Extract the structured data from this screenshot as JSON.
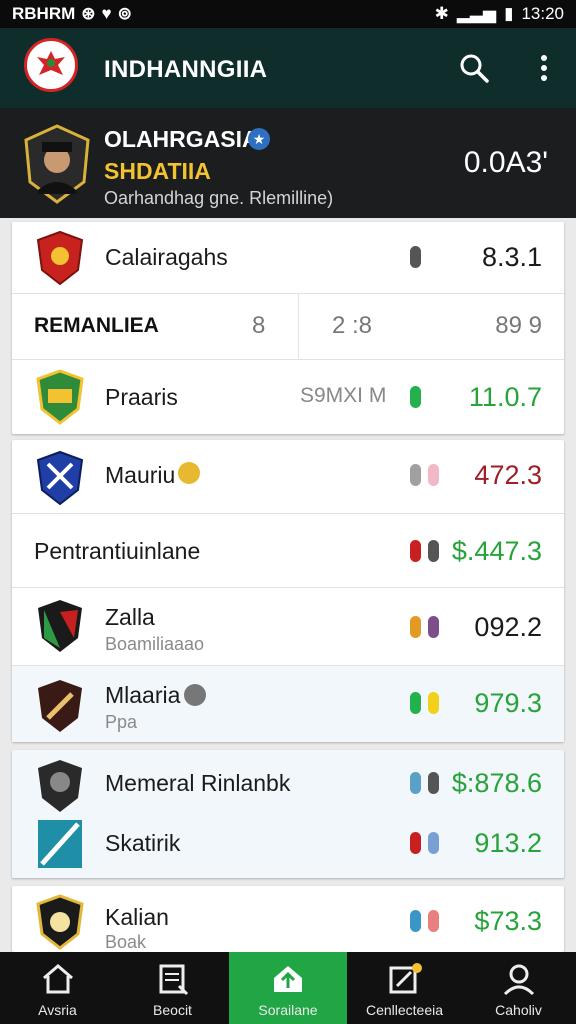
{
  "status": {
    "carrier": "RBHRM",
    "time": "13:20"
  },
  "app": {
    "title": "INDHANNGIIA"
  },
  "profile": {
    "name": "OLAHRGASIA",
    "team": "SHDATIIA",
    "desc": "Oarhandhag gne. Rlemilline)",
    "score": "0.0A3'"
  },
  "rows": [
    {
      "name": "Calairagahs",
      "value": "8.3.1",
      "value_color": "#1b1b1b",
      "dots": [
        "#555555"
      ]
    },
    {
      "header": true,
      "name": "REMANLIEA",
      "c1": "8",
      "c2": "2 :8",
      "c3": "89 9"
    },
    {
      "name": "Praaris",
      "mid": "S9MXI M",
      "value": "11.0.7",
      "value_color": "#27a33a",
      "dots": [
        "#22b14c"
      ]
    },
    {
      "name": "Mauriu",
      "value": "472.3",
      "value_color": "#a01d2a",
      "dots": [
        "#a0a0a0",
        "#f2b8c6"
      ]
    },
    {
      "name": "Pentrantiuinlane",
      "value": "$.447.3",
      "value_color": "#27a33a",
      "dots": [
        "#c82020",
        "#555555"
      ]
    },
    {
      "name": "Zalla",
      "sub": "Boamiliaaao",
      "value": "092.2",
      "value_color": "#1b1b1b",
      "dots": [
        "#e39a22",
        "#7d4f8a"
      ]
    },
    {
      "name": "Mlaaria",
      "sub": "Ppa",
      "value": "979.3",
      "value_color": "#27a33a",
      "dots": [
        "#22b14c",
        "#f2d11b"
      ]
    },
    {
      "name": "Memeral Rinlanbk",
      "value": "$:878.6",
      "value_color": "#27a33a",
      "dots": [
        "#5aa0c7",
        "#555555"
      ]
    },
    {
      "name": "Skatirik",
      "value": "913.2",
      "value_color": "#27a33a",
      "dots": [
        "#c82020",
        "#7aa0d3"
      ]
    },
    {
      "name": "Kalian",
      "sub": "Boak",
      "value": "$73.3",
      "value_color": "#27a33a",
      "dots": [
        "#3b96c8",
        "#e88080"
      ]
    }
  ],
  "nav": [
    {
      "label": "Avsria",
      "icon": "home-icon"
    },
    {
      "label": "Beocit",
      "icon": "list-icon"
    },
    {
      "label": "Sorailane",
      "icon": "upload-icon",
      "active": true
    },
    {
      "label": "Cenllecteeia",
      "icon": "edit-notification-icon"
    },
    {
      "label": "Caholiv",
      "icon": "profile-icon"
    }
  ]
}
